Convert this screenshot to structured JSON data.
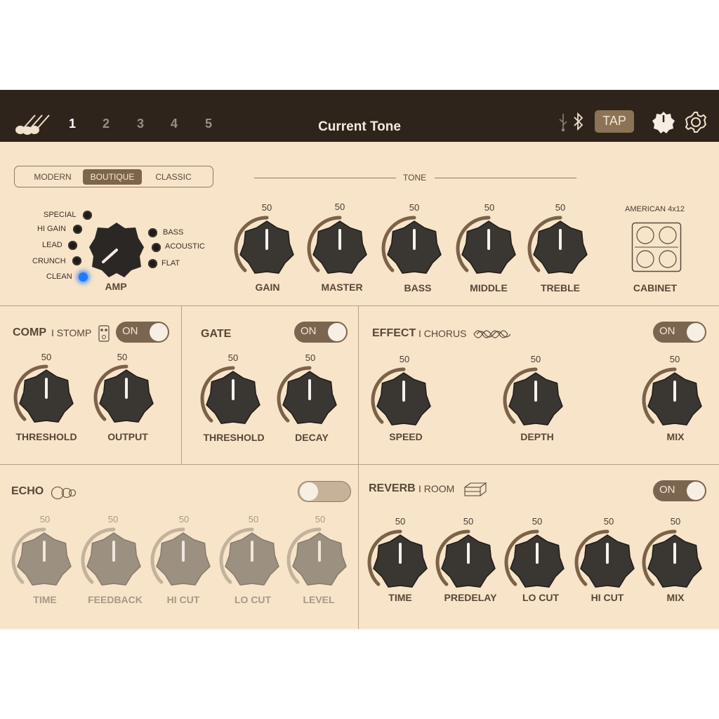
{
  "header": {
    "presets": [
      "1",
      "2",
      "3",
      "4",
      "5"
    ],
    "title": "Current Tone",
    "tap_label": "TAP"
  },
  "amp": {
    "styles": [
      "MODERN",
      "BOUTIQUE",
      "CLASSIC"
    ],
    "selected_style": "BOUTIQUE",
    "tone_label": "TONE",
    "left_modes": [
      "SPECIAL",
      "HI GAIN",
      "LEAD",
      "CRUNCH",
      "CLEAN"
    ],
    "right_modes": [
      "BASS",
      "ACOUSTIC",
      "FLAT"
    ],
    "active_mode": "CLEAN",
    "amp_label": "AMP",
    "knobs": [
      {
        "label": "GAIN",
        "value": "50"
      },
      {
        "label": "MASTER",
        "value": "50"
      },
      {
        "label": "BASS",
        "value": "50"
      },
      {
        "label": "MIDDLE",
        "value": "50"
      },
      {
        "label": "TREBLE",
        "value": "50"
      }
    ],
    "cabinet_name": "AMERICAN 4x12",
    "cabinet_label": "CABINET"
  },
  "comp": {
    "title": "COMP",
    "type": "I STOMP",
    "toggle": "ON",
    "knobs": [
      {
        "label": "THRESHOLD",
        "value": "50"
      },
      {
        "label": "OUTPUT",
        "value": "50"
      }
    ]
  },
  "gate": {
    "title": "GATE",
    "toggle": "ON",
    "knobs": [
      {
        "label": "THRESHOLD",
        "value": "50"
      },
      {
        "label": "DECAY",
        "value": "50"
      }
    ]
  },
  "effect": {
    "title": "EFFECT",
    "type": "I CHORUS",
    "toggle": "ON",
    "knobs": [
      {
        "label": "SPEED",
        "value": "50"
      },
      {
        "label": "DEPTH",
        "value": "50"
      },
      {
        "label": "MIX",
        "value": "50"
      }
    ]
  },
  "echo": {
    "title": "ECHO",
    "enabled": false,
    "knobs": [
      {
        "label": "TIME",
        "value": "50"
      },
      {
        "label": "FEEDBACK",
        "value": "50"
      },
      {
        "label": "HI CUT",
        "value": "50"
      },
      {
        "label": "LO CUT",
        "value": "50"
      },
      {
        "label": "LEVEL",
        "value": "50"
      }
    ]
  },
  "reverb": {
    "title": "REVERB",
    "type": "I ROOM",
    "toggle": "ON",
    "knobs": [
      {
        "label": "TIME",
        "value": "50"
      },
      {
        "label": "PREDELAY",
        "value": "50"
      },
      {
        "label": "LO CUT",
        "value": "50"
      },
      {
        "label": "HI CUT",
        "value": "50"
      },
      {
        "label": "MIX",
        "value": "50"
      }
    ]
  },
  "colors": {
    "header_bg": "#2e241c",
    "panel_bg": "#f8e4c9",
    "accent": "#7c6550",
    "led_on": "#1c7cff"
  },
  "icons": [
    "guitars-icon",
    "usb-icon",
    "bluetooth-icon",
    "tuner-icon",
    "gear-icon",
    "stomp-icon",
    "chorus-wave-icon",
    "echo-circles-icon",
    "room-box-icon",
    "cabinet-icon"
  ]
}
